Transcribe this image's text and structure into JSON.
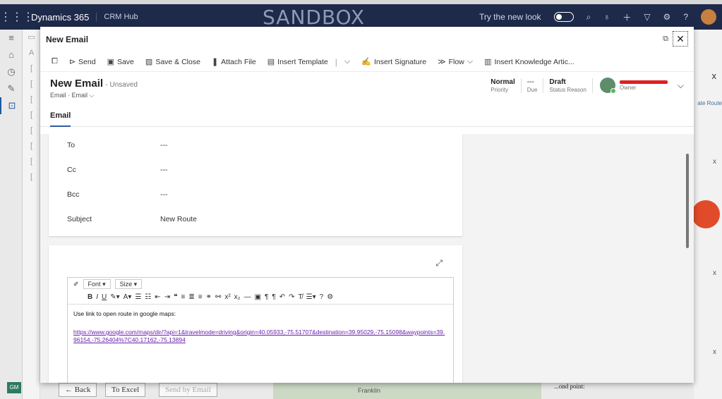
{
  "topbar": {
    "brand": "Dynamics 365",
    "app_name": "CRM Hub",
    "environment": "SANDBOX",
    "try_new_look": "Try the new look"
  },
  "modal": {
    "title": "New Email"
  },
  "commands": [
    {
      "label": "Send",
      "icon": "send-icon"
    },
    {
      "label": "Save",
      "icon": "save-icon"
    },
    {
      "label": "Save & Close",
      "icon": "save-close-icon"
    },
    {
      "label": "Attach File",
      "icon": "paperclip-icon"
    },
    {
      "label": "Insert Template",
      "icon": "template-icon"
    },
    {
      "label": "Insert Signature",
      "icon": "signature-icon"
    },
    {
      "label": "Flow",
      "icon": "flow-icon"
    },
    {
      "label": "Insert Knowledge Artic...",
      "icon": "knowledge-icon"
    }
  ],
  "record": {
    "title": "New Email",
    "status": "- Unsaved",
    "subtitle": "Email · Email ⌵"
  },
  "header_fields": {
    "priority_value": "Normal",
    "priority_label": "Priority",
    "due_value": "---",
    "due_label": "Due",
    "status_value": "Draft",
    "status_label": "Status Reason",
    "owner_label": "Owner"
  },
  "tabs": [
    "Email"
  ],
  "form": {
    "to_label": "To",
    "to_value": "---",
    "cc_label": "Cc",
    "cc_value": "---",
    "bcc_label": "Bcc",
    "bcc_value": "---",
    "subject_label": "Subject",
    "subject_value": "New Route"
  },
  "editor": {
    "font_label": "Font",
    "size_label": "Size",
    "body_text": "Use link to open route in google maps:",
    "link_text": "https://www.google.com/maps/dir/?api=1&travelmode=driving&origin=40.05933,-75.51707&destination=39.95029,-75.15098&waypoints=39.96154,-75.26404%7C40.17162,-75.13894"
  },
  "background": {
    "route_link": "ate Route",
    "back_button": "← Back",
    "excel_button": "To Excel",
    "send_email_button": "Send by Email",
    "map_label": "Franklin",
    "stat_label": "...ond point:",
    "gm_badge": "GM"
  },
  "colors": {
    "topbar": "#1e2a4a",
    "accent": "#2f5ba8",
    "link": "#6a1fb0",
    "fab": "#e14b2a"
  }
}
